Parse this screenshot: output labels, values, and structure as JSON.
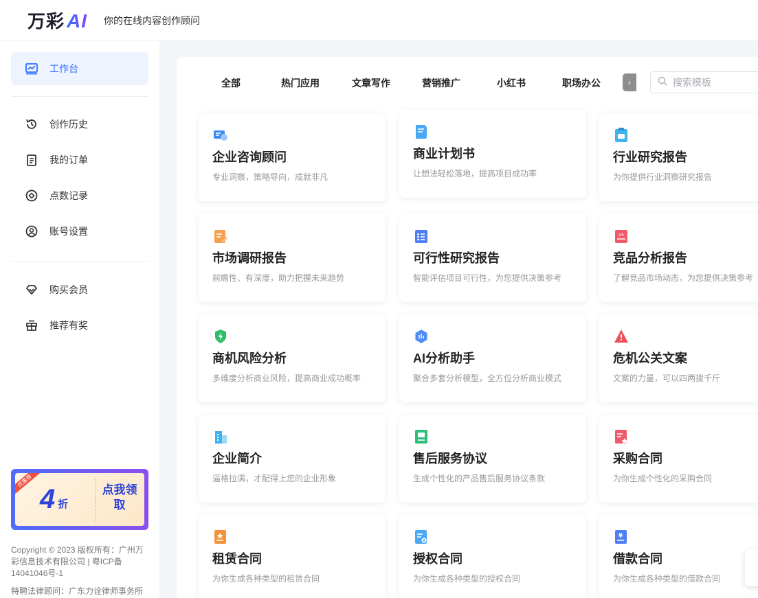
{
  "header": {
    "logo_text": "万彩",
    "logo_ai": "AI",
    "tagline": "你的在线内容创作顾问"
  },
  "sidebar": {
    "items": [
      {
        "label": "工作台",
        "icon": "chart-line-icon"
      },
      {
        "label": "创作历史",
        "icon": "history-icon"
      },
      {
        "label": "我的订单",
        "icon": "clipboard-icon"
      },
      {
        "label": "点数记录",
        "icon": "coin-icon"
      },
      {
        "label": "账号设置",
        "icon": "user-circle-icon"
      },
      {
        "label": "购买会员",
        "icon": "diamond-icon"
      },
      {
        "label": "推荐有奖",
        "icon": "gift-icon"
      }
    ],
    "promo": {
      "ribbon": "优惠券",
      "number": "4",
      "unit": "折",
      "cta": "点我领取"
    },
    "copyright": "Copyright © 2023 版权所有：广州万彩信息技术有限公司 | 粤ICP备14041046号-1",
    "legal": "特聘法律顾问：广东力诠律师事务所"
  },
  "tabs": [
    "全部",
    "热门应用",
    "文章写作",
    "营销推广",
    "小红书",
    "职场办公"
  ],
  "tab_more": "›",
  "search": {
    "placeholder": "搜索模板"
  },
  "cards": [
    {
      "title": "企业咨询顾问",
      "desc": "专业洞察，策略导向，成就非凡",
      "icon": "consult-card-icon",
      "color": "#3b8cf5"
    },
    {
      "title": "商业计划书",
      "desc": "让想法轻松落地，提高项目成功率",
      "icon": "document-icon",
      "color": "#4aa8f5"
    },
    {
      "title": "行业研究报告",
      "desc": "为你提供行业洞察研究报告",
      "icon": "report-icon",
      "color": "#3fb3f0"
    },
    {
      "title": "市场调研报告",
      "desc": "前瞻性、有深度，助力把握未来趋势",
      "icon": "clipboard-edit-icon",
      "color": "#f5a04a"
    },
    {
      "title": "可行性研究报告",
      "desc": "智能评估项目可行性，为您提供决策参考",
      "icon": "checklist-icon",
      "color": "#4f7ef5"
    },
    {
      "title": "竞品分析报告",
      "desc": "了解竞品市场动态，为您提供决策参考",
      "icon": "versus-icon",
      "color": "#f05a6a"
    },
    {
      "title": "商机风险分析",
      "desc": "多维度分析商业风险，提高商业成功概率",
      "icon": "shield-bolt-icon",
      "color": "#2fbf6a"
    },
    {
      "title": "AI分析助手",
      "desc": "聚合多套分析模型，全方位分析商业模式",
      "icon": "hexagon-chart-icon",
      "color": "#4f8ef5"
    },
    {
      "title": "危机公关文案",
      "desc": "文案的力量，可以四两拨千斤",
      "icon": "warning-icon",
      "color": "#f0505a"
    },
    {
      "title": "企业简介",
      "desc": "逼格拉满，才配得上您的企业形象",
      "icon": "building-icon",
      "color": "#3fb3f0"
    },
    {
      "title": "售后服务协议",
      "desc": "生成个性化的产品售后服务协议条款",
      "icon": "agreement-icon",
      "color": "#2fbf7a"
    },
    {
      "title": "采购合同",
      "desc": "为你生成个性化的采购合同",
      "icon": "contract-star-icon",
      "color": "#f05a6a"
    },
    {
      "title": "租赁合同",
      "desc": "为你生成各种类型的租赁合同",
      "icon": "lease-contract-icon",
      "color": "#f5923a"
    },
    {
      "title": "授权合同",
      "desc": "为你生成各种类型的授权合同",
      "icon": "license-contract-icon",
      "color": "#4aa8f5"
    },
    {
      "title": "借款合同",
      "desc": "为你生成各种类型的借款合同",
      "icon": "loan-contract-icon",
      "color": "#4f7ef5"
    }
  ]
}
